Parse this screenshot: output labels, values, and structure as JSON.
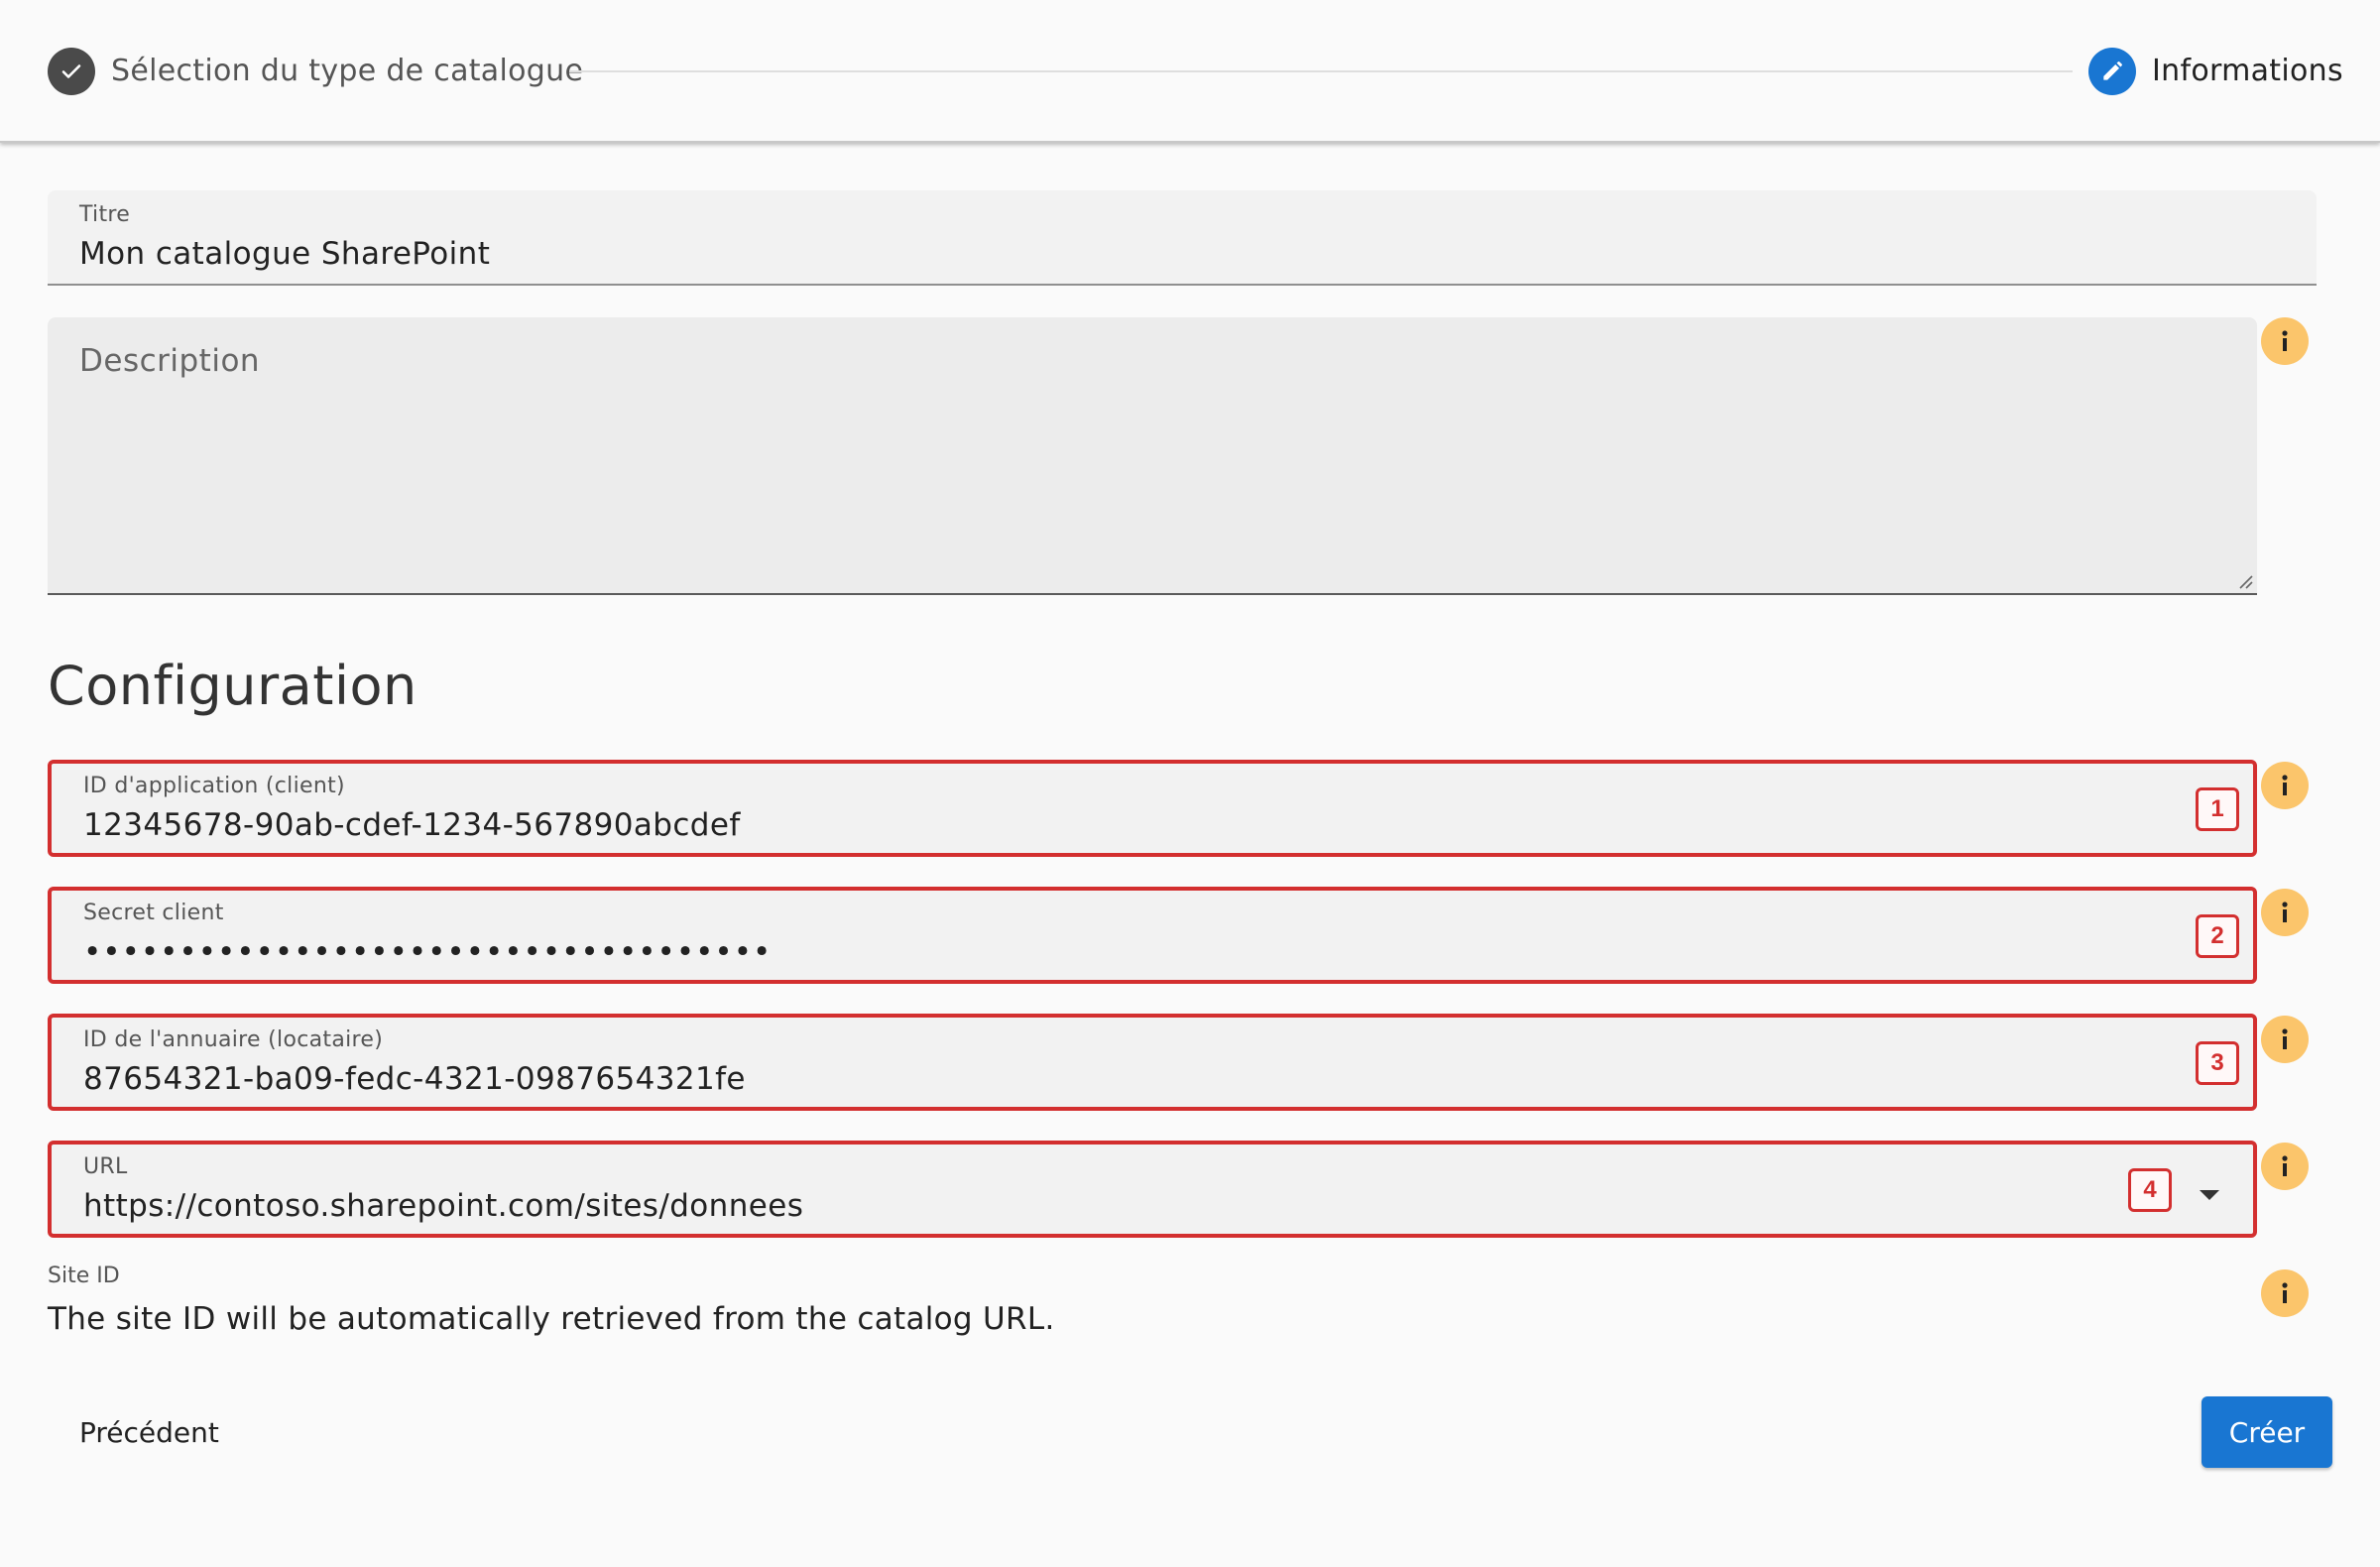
{
  "stepper": {
    "step1_label": "Sélection du type de catalogue",
    "step2_label": "Informations",
    "step1_icon": "check-icon",
    "step2_icon": "pencil-icon"
  },
  "form": {
    "title": {
      "label": "Titre",
      "value": "Mon catalogue SharePoint"
    },
    "description": {
      "placeholder": "Description"
    }
  },
  "configuration": {
    "heading": "Configuration",
    "client_id": {
      "label": "ID d'application (client)",
      "value": "12345678-90ab-cdef-1234-567890abcdef",
      "badge": "1"
    },
    "client_secret": {
      "label": "Secret client",
      "value": "••••••••••••••••••••••••••••••••••••",
      "badge": "2"
    },
    "tenant_id": {
      "label": "ID de l'annuaire (locataire)",
      "value": "87654321-ba09-fedc-4321-0987654321fe",
      "badge": "3"
    },
    "url": {
      "label": "URL",
      "value": "https://contoso.sharepoint.com/sites/donnees",
      "badge": "4"
    },
    "site_id": {
      "label": "Site ID",
      "text": "The site ID will be automatically retrieved from the catalog URL."
    }
  },
  "actions": {
    "previous_label": "Précédent",
    "create_label": "Créer"
  },
  "colors": {
    "primary": "#1976d2",
    "highlight_border": "#d32f2f",
    "info_icon": "#fbc56b",
    "step_done": "#4a4a4a"
  }
}
